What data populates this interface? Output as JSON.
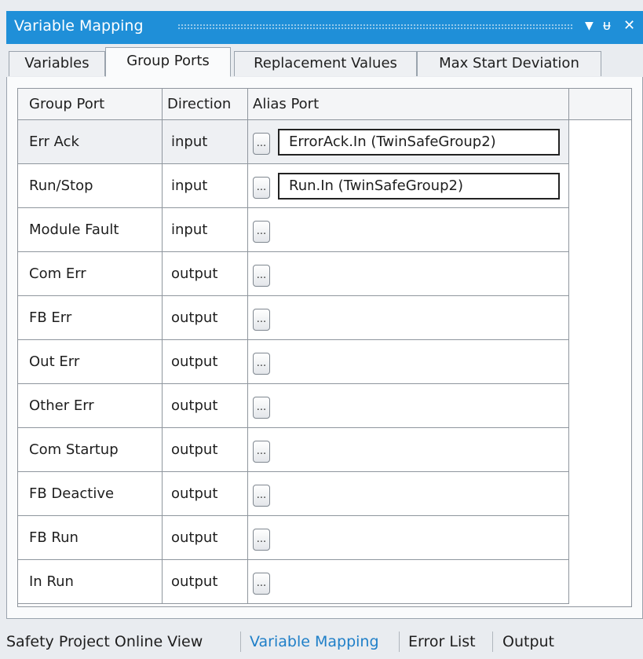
{
  "window": {
    "title": "Variable Mapping",
    "dropdown_glyph": "▼",
    "pin_glyph": "ᵾ",
    "close_glyph": "✕"
  },
  "tabs": [
    {
      "label": "Variables"
    },
    {
      "label": "Group Ports"
    },
    {
      "label": "Replacement Values"
    },
    {
      "label": "Max Start Deviation"
    }
  ],
  "table": {
    "headers": {
      "group_port": "Group Port",
      "direction": "Direction",
      "alias_port": "Alias Port"
    },
    "ellipsis_label": "...",
    "rows": [
      {
        "port": "Err Ack",
        "direction": "input",
        "alias": "ErrorAck.In (TwinSafeGroup2)"
      },
      {
        "port": "Run/Stop",
        "direction": "input",
        "alias": "Run.In (TwinSafeGroup2)"
      },
      {
        "port": "Module Fault",
        "direction": "input",
        "alias": ""
      },
      {
        "port": "Com Err",
        "direction": "output",
        "alias": ""
      },
      {
        "port": "FB Err",
        "direction": "output",
        "alias": ""
      },
      {
        "port": "Out Err",
        "direction": "output",
        "alias": ""
      },
      {
        "port": "Other Err",
        "direction": "output",
        "alias": ""
      },
      {
        "port": "Com Startup",
        "direction": "output",
        "alias": ""
      },
      {
        "port": "FB Deactive",
        "direction": "output",
        "alias": ""
      },
      {
        "port": "FB Run",
        "direction": "output",
        "alias": ""
      },
      {
        "port": "In Run",
        "direction": "output",
        "alias": ""
      }
    ]
  },
  "bottom_tabs": [
    {
      "label": "Safety Project Online View"
    },
    {
      "label": "Variable Mapping"
    },
    {
      "label": "Error List"
    },
    {
      "label": "Output"
    }
  ],
  "colors": {
    "accent": "#1f8fd8",
    "active_link": "#1f7fc8"
  }
}
